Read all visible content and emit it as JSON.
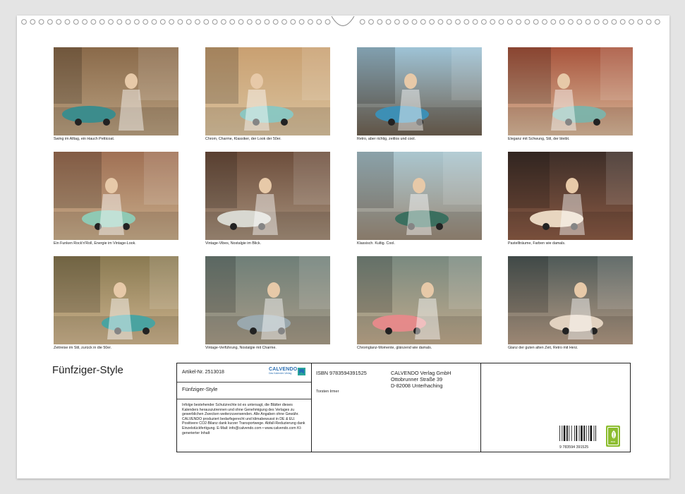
{
  "calendar": {
    "title": "Fünfziger-Style"
  },
  "tiles": [
    {
      "caption": "Swing im Alltag, ein Hauch Petticoat.",
      "sky": "#8a6a4a",
      "ground": "#b9a080",
      "accent": "#3c8c8c"
    },
    {
      "caption": "Chrom, Charme, Klassiker, der Look der 50er.",
      "sky": "#c9a071",
      "ground": "#d9c29e",
      "accent": "#8cc6c0"
    },
    {
      "caption": "Retro, aber richtig, zeitlos und cool.",
      "sky": "#9ec3d6",
      "ground": "#6e6050",
      "accent": "#3d8fb5"
    },
    {
      "caption": "Eleganz mit Schwung, Stil, der bleibt.",
      "sky": "#a8543c",
      "ground": "#d8b89a",
      "accent": "#7fb2a8"
    },
    {
      "caption": "Ein Funken Rock'n'Roll, Energie im Vintage-Look.",
      "sky": "#a07054",
      "ground": "#c7ac8a",
      "accent": "#8fc9b4"
    },
    {
      "caption": "Vintage-Vibes, Nostalgie im Blick.",
      "sky": "#6d4e3c",
      "ground": "#a58f7a",
      "accent": "#d8d8d0"
    },
    {
      "caption": "Klassisch. Kultig. Cool.",
      "sky": "#aac6cf",
      "ground": "#9a8a78",
      "accent": "#3b6f5f"
    },
    {
      "caption": "Pastellträume, Farben wie damals.",
      "sky": "#3d2e28",
      "ground": "#8a5a44",
      "accent": "#e8d6c0"
    },
    {
      "caption": "Zeitreise im Stil, zurück in die 50er.",
      "sky": "#8a7a52",
      "ground": "#cdb48e",
      "accent": "#4aa3a0"
    },
    {
      "caption": "Vintage-Verführung, Nostalgie mit Charme.",
      "sky": "#6f7f78",
      "ground": "#a89c88",
      "accent": "#9aa8ae"
    },
    {
      "caption": "Chromglanz-Momente, glänzend wie damals.",
      "sky": "#7a8a80",
      "ground": "#c0aa8c",
      "accent": "#e48a8a"
    },
    {
      "caption": "Glanz der guten alten Zeit, Retro mit Herz.",
      "sky": "#4f5a58",
      "ground": "#b29a84",
      "accent": "#e2d2c0"
    }
  ],
  "info": {
    "article": "Artikel-Nr. 2513018",
    "logo_word": "CALVENDO",
    "logo_sub": "Das Kalender-Verlag",
    "small_title": "Fünfziger-Style",
    "legal": "Infolge bestehender Schutzrechte ist es untersagt, die Blätter dieses Kalenders herauszutrennen und ohne Genehmigung des Verlages zu gewerblichen Zwecken weiterzuverwenden. Alle Angaben ohne Gewähr. CALVENDO produziert bedarfsgerecht und klimabewusst in DE & EU. Positivere CO2-Bilanz dank kurzer Transportwege. Abfall-Reduzierung dank Einzelstückfertigung. E-Mail: info@calvendo.com • www.calvendo.com KI-generierter Inhalt",
    "isbn": "ISBN 9783594391525",
    "publisher_name": "CALVENDO Verlag GmbH",
    "publisher_street": "Ottobrunner Straße 39",
    "publisher_city": "D-82008 Unterhaching",
    "author": "Torsten Irmer",
    "barcode_number": "9 783594 391525",
    "eco_label": "eco"
  }
}
